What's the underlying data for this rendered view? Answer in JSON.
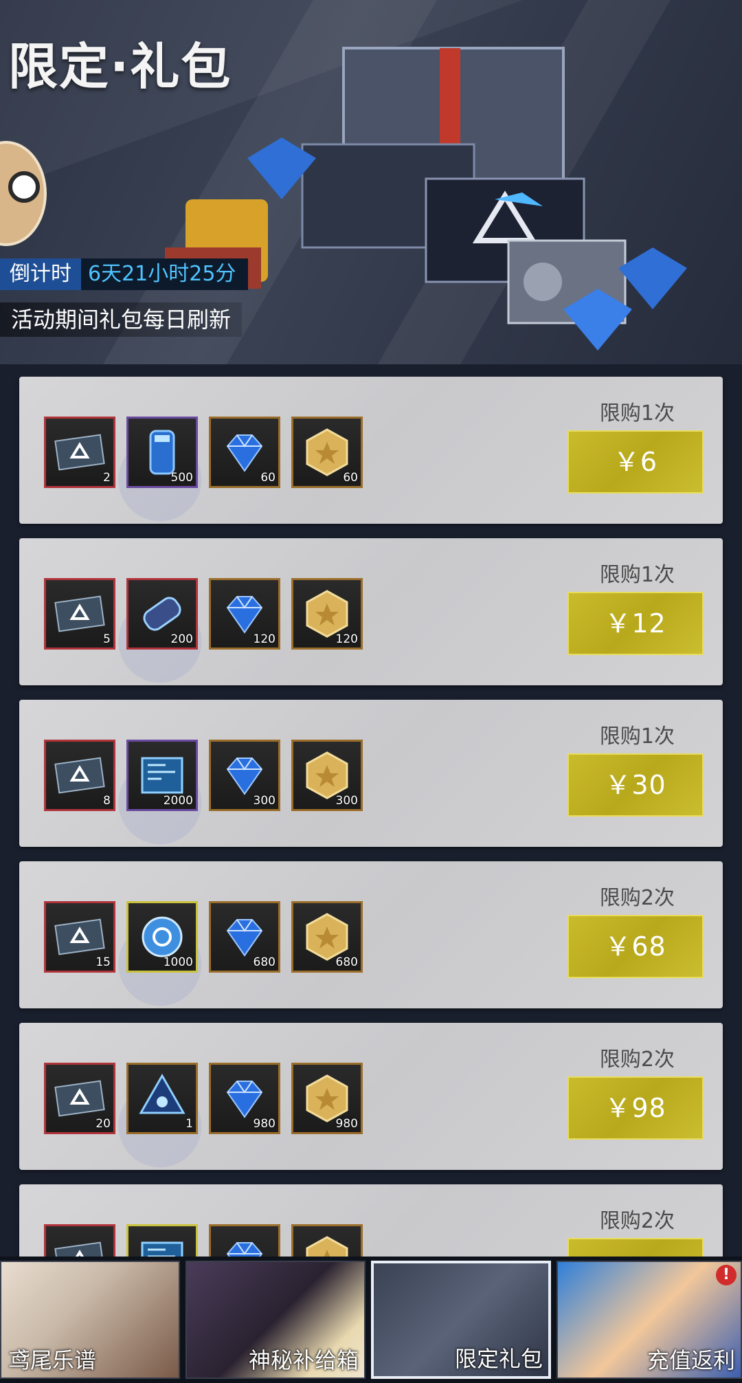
{
  "banner": {
    "title": "限定·礼包",
    "countdown_label": "倒计时",
    "countdown_value": "6天21小时25分",
    "refresh_note": "活动期间礼包每日刷新"
  },
  "packs": [
    {
      "limit": "限购1次",
      "price": "￥6",
      "items": [
        {
          "icon": "ticket-icon",
          "frame": "red",
          "qty": "2"
        },
        {
          "icon": "battery-icon",
          "frame": "purple",
          "qty": "500"
        },
        {
          "icon": "diamond-icon",
          "frame": "gold",
          "qty": "60"
        },
        {
          "icon": "gold-coin-icon",
          "frame": "gold",
          "qty": "60"
        }
      ]
    },
    {
      "limit": "限购1次",
      "price": "￥12",
      "items": [
        {
          "icon": "ticket-icon",
          "frame": "red",
          "qty": "5"
        },
        {
          "icon": "capsule-icon",
          "frame": "red",
          "qty": "200"
        },
        {
          "icon": "diamond-icon",
          "frame": "gold",
          "qty": "120"
        },
        {
          "icon": "gold-coin-icon",
          "frame": "gold",
          "qty": "120"
        }
      ]
    },
    {
      "limit": "限购1次",
      "price": "￥30",
      "items": [
        {
          "icon": "ticket-icon",
          "frame": "red",
          "qty": "8"
        },
        {
          "icon": "chip-icon",
          "frame": "purple",
          "qty": "2000"
        },
        {
          "icon": "diamond-icon",
          "frame": "gold",
          "qty": "300"
        },
        {
          "icon": "gold-coin-icon",
          "frame": "gold",
          "qty": "300"
        }
      ]
    },
    {
      "limit": "限购2次",
      "price": "￥68",
      "items": [
        {
          "icon": "ticket-icon",
          "frame": "red",
          "qty": "15"
        },
        {
          "icon": "orb-icon",
          "frame": "yellow",
          "qty": "1000"
        },
        {
          "icon": "diamond-icon",
          "frame": "gold",
          "qty": "680"
        },
        {
          "icon": "gold-coin-icon",
          "frame": "gold",
          "qty": "680"
        }
      ]
    },
    {
      "limit": "限购2次",
      "price": "￥98",
      "items": [
        {
          "icon": "ticket-icon",
          "frame": "red",
          "qty": "20"
        },
        {
          "icon": "crystal-core-icon",
          "frame": "gold",
          "qty": "1"
        },
        {
          "icon": "diamond-icon",
          "frame": "gold",
          "qty": "980"
        },
        {
          "icon": "gold-coin-icon",
          "frame": "gold",
          "qty": "980"
        }
      ]
    },
    {
      "limit": "限购2次",
      "price": "",
      "items": [
        {
          "icon": "ticket-icon",
          "frame": "red",
          "qty": ""
        },
        {
          "icon": "chip-icon",
          "frame": "yellow",
          "qty": ""
        },
        {
          "icon": "diamond-icon",
          "frame": "gold",
          "qty": ""
        },
        {
          "icon": "gold-coin-icon",
          "frame": "gold",
          "qty": ""
        }
      ]
    }
  ],
  "tabs": [
    {
      "label": "鸢尾乐谱",
      "active": false,
      "alert": false
    },
    {
      "label": "神秘补给箱",
      "active": false,
      "alert": false
    },
    {
      "label": "限定礼包",
      "active": true,
      "alert": false
    },
    {
      "label": "充值返利",
      "active": false,
      "alert": true,
      "alert_text": "!"
    }
  ],
  "colors": {
    "buy_button": "#c2b325",
    "countdown_bg": "#1e4f96",
    "countdown_text": "#4fc4ff",
    "alert": "#d22b2b"
  }
}
